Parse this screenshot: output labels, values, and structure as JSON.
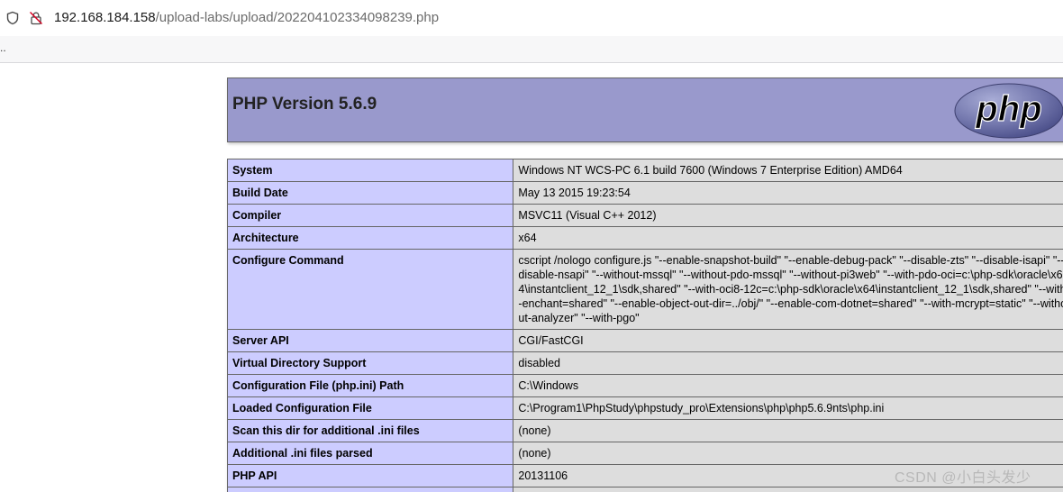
{
  "browser": {
    "url_host": "192.168.184.158",
    "url_path": "/upload-labs/upload/202204102334098239.php",
    "tab_strip_text": ".."
  },
  "php": {
    "title": "PHP Version 5.6.9",
    "logo_text": "php",
    "rows": [
      {
        "key": "System",
        "value": "Windows NT WCS-PC 6.1 build 7600 (Windows 7 Enterprise Edition) AMD64"
      },
      {
        "key": "Build Date",
        "value": "May 13 2015 19:23:54"
      },
      {
        "key": "Compiler",
        "value": "MSVC11 (Visual C++ 2012)"
      },
      {
        "key": "Architecture",
        "value": "x64"
      },
      {
        "key": "Configure Command",
        "value": "cscript /nologo configure.js \"--enable-snapshot-build\" \"--enable-debug-pack\" \"--disable-zts\" \"--disable-isapi\" \"--disable-nsapi\" \"--without-mssql\" \"--without-pdo-mssql\" \"--without-pi3web\" \"--with-pdo-oci=c:\\php-sdk\\oracle\\x64\\instantclient_12_1\\sdk,shared\" \"--with-oci8-12c=c:\\php-sdk\\oracle\\x64\\instantclient_12_1\\sdk,shared\" \"--with-enchant=shared\" \"--enable-object-out-dir=../obj/\" \"--enable-com-dotnet=shared\" \"--with-mcrypt=static\" \"--without-analyzer\" \"--with-pgo\""
      },
      {
        "key": "Server API",
        "value": "CGI/FastCGI"
      },
      {
        "key": "Virtual Directory Support",
        "value": "disabled"
      },
      {
        "key": "Configuration File (php.ini) Path",
        "value": "C:\\Windows"
      },
      {
        "key": "Loaded Configuration File",
        "value": "C:\\Program1\\PhpStudy\\phpstudy_pro\\Extensions\\php\\php5.6.9nts\\php.ini"
      },
      {
        "key": "Scan this dir for additional .ini files",
        "value": "(none)"
      },
      {
        "key": "Additional .ini files parsed",
        "value": "(none)"
      },
      {
        "key": "PHP API",
        "value": "20131106"
      },
      {
        "key": "",
        "value": ""
      }
    ]
  },
  "watermark": "CSDN @小白头发少"
}
